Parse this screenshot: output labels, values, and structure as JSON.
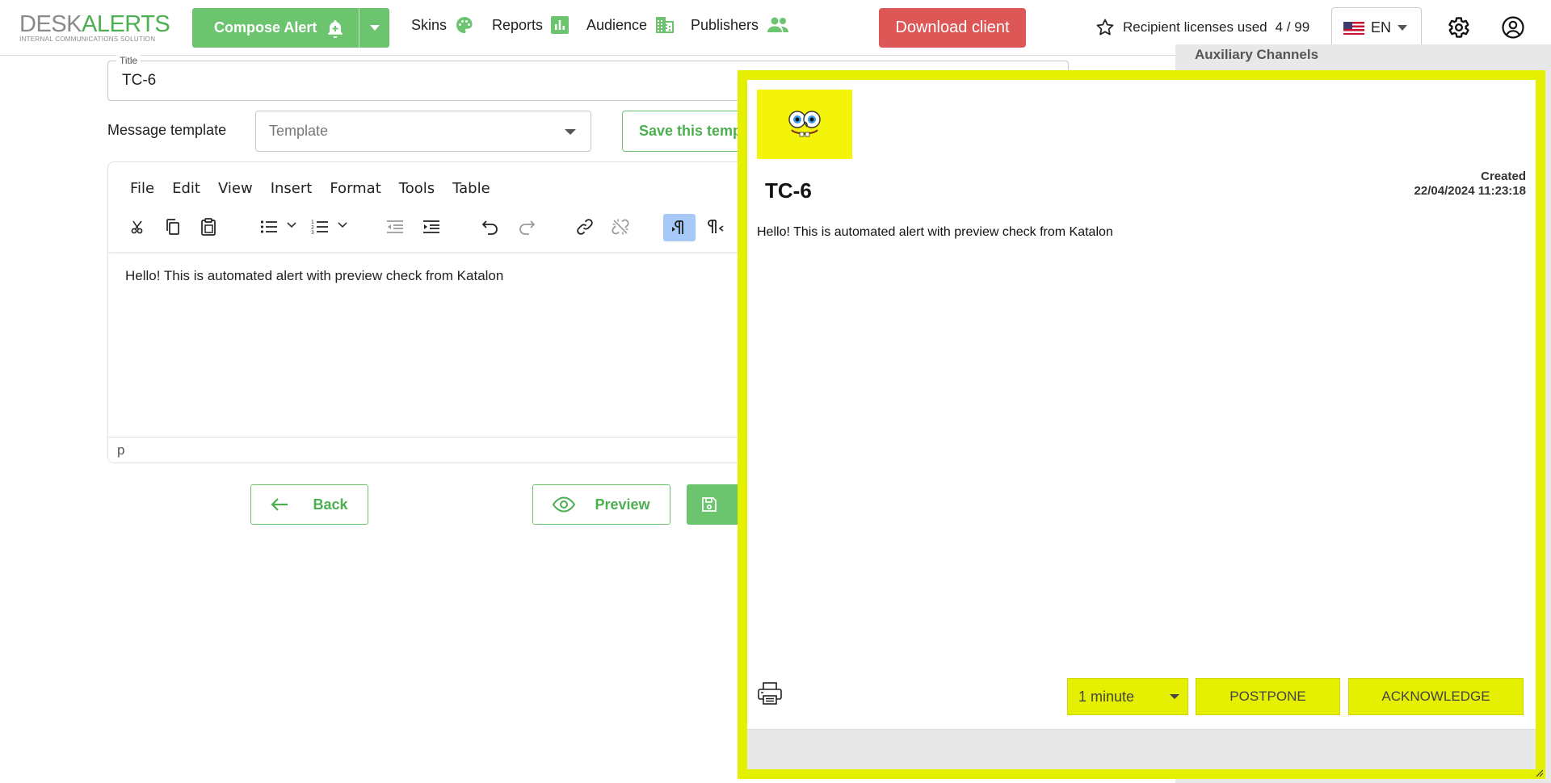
{
  "brand": {
    "logo_part1": "DESK",
    "logo_part2": "ALERTS",
    "tagline": "INTERNAL COMMUNICATIONS SOLUTION",
    "accent": "#6cc46f",
    "accent_text": "#4caf50"
  },
  "nav": {
    "compose_label": "Compose Alert",
    "items": [
      {
        "label": "Skins",
        "icon": "palette-icon"
      },
      {
        "label": "Reports",
        "icon": "bar-chart-icon"
      },
      {
        "label": "Audience",
        "icon": "audience-icon"
      },
      {
        "label": "Publishers",
        "icon": "people-icon"
      }
    ],
    "download_label": "Download client",
    "download_color": "#de5757",
    "licenses_label": "Recipient licenses used",
    "licenses_value": "4 / 99",
    "language": "EN"
  },
  "form": {
    "title_legend": "Title",
    "title_value": "TC-6",
    "template_label": "Message template",
    "template_placeholder": "Template",
    "save_template_label": "Save this template"
  },
  "editor": {
    "menu": [
      "File",
      "Edit",
      "View",
      "Insert",
      "Format",
      "Tools",
      "Table"
    ],
    "body_text": "Hello! This is automated alert with preview check from Katalon",
    "status_path": "p"
  },
  "actions": {
    "back_label": "Back",
    "preview_label": "Preview"
  },
  "right_panel": {
    "heading": "Auxiliary Channels"
  },
  "preview_popup": {
    "border_color": "#e5ef00",
    "title": "TC-6",
    "created_label": "Created",
    "created_value": "22/04/2024 11:23:18",
    "body": "Hello! This is automated alert with preview check from Katalon",
    "interval_value": "1 minute",
    "postpone_label": "POSTPONE",
    "acknowledge_label": "ACKNOWLEDGE"
  }
}
